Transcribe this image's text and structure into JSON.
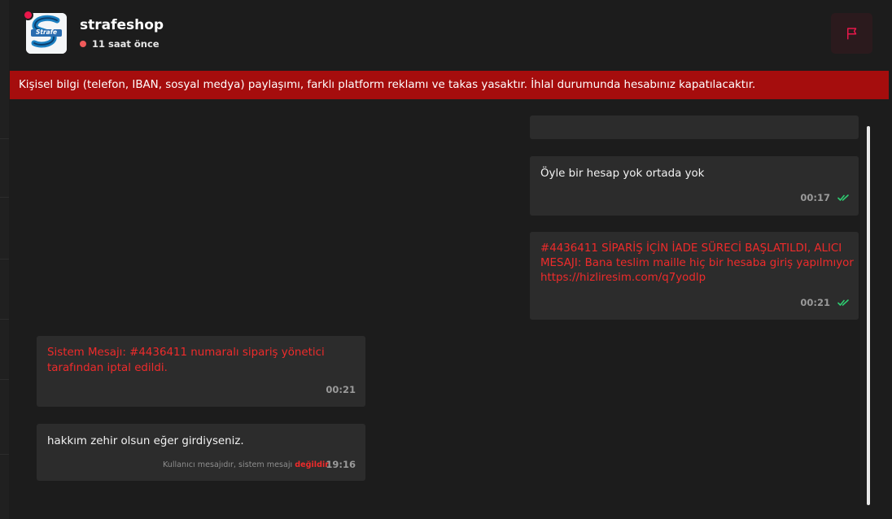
{
  "header": {
    "shop_name": "strafeshop",
    "last_seen": "11 saat önce",
    "avatar_logo_text": "Strafe"
  },
  "warning": {
    "text": "Kişisel bilgi (telefon, IBAN, sosyal medya) paylaşımı, farklı platform reklamı ve takas yasaktır. İhlal durumunda hesabınız kapatılacaktır."
  },
  "messages": [
    {
      "side": "right",
      "lines": [
        "Öyle bir hesap yok ortada yok"
      ],
      "time": "00:17",
      "read": true,
      "color": "#f2f2f2"
    },
    {
      "side": "right",
      "lines": [
        "#4436411 SİPARİŞ İÇİN İADE SÜRECİ BAŞLATILDI, ALICI",
        "MESAJI: Bana teslim maille hiç bir hesaba giriş yapılmıyor",
        "https://hizliresim.com/q7yodlp"
      ],
      "time": "00:21",
      "read": true,
      "color": "#ee2b2b"
    },
    {
      "side": "left",
      "lines": [
        "Sistem Mesajı: #4436411 numaralı sipariş yönetici",
        "tarafından iptal edildi."
      ],
      "time": "00:21",
      "color": "#ee2b2b"
    },
    {
      "side": "left",
      "lines": [
        "hakkım zehir olsun eğer girdiyseniz."
      ],
      "time": "19:16",
      "note": "Kullanıcı mesajıdır, sistem mesajı",
      "note_highlight": "değildir",
      "color": "#f2f2f2"
    }
  ],
  "colors": {
    "accent_red": "#ee2b2b",
    "banner_red": "#a50d0d",
    "read_check_green": "#2ecc71",
    "bubble_bg": "#2c2c2c",
    "page_bg": "#1c1c1c"
  }
}
